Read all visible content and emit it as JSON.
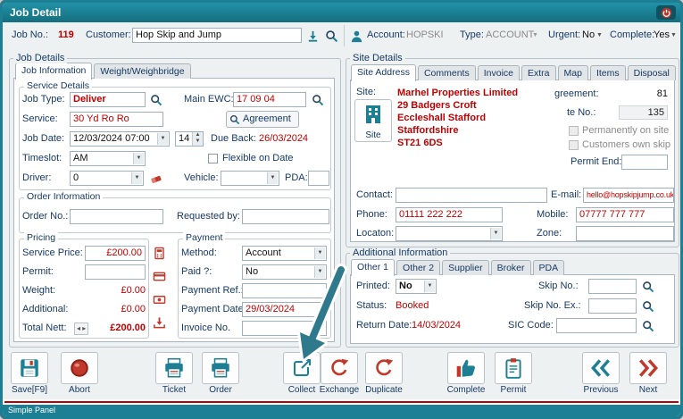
{
  "window": {
    "title": "Job Detail"
  },
  "header": {
    "job_no_label": "Job No.:",
    "job_no": "119",
    "customer_label": "Customer:",
    "customer_value": "Hop Skip and Jump",
    "account_label": "Account:",
    "account_value": "HOPSKI",
    "type_label": "Type:",
    "type_value": "ACCOUNT",
    "urgent_label": "Urgent:",
    "urgent_value": "No",
    "complete_label": "Complete:",
    "complete_value": "Yes"
  },
  "job": {
    "group_label": "Job Details",
    "tabs": [
      "Job Information",
      "Weight/Weighbridge"
    ],
    "service": {
      "legend": "Service Details",
      "job_type_label": "Job Type:",
      "job_type": "Deliver",
      "main_ewc_label": "Main EWC:",
      "main_ewc": "17 09 04",
      "service_label": "Service:",
      "service_value": "30 Yd Ro Ro",
      "agreement_button": "Agreement",
      "job_date_label": "Job Date:",
      "job_date": "12/03/2024 07:00",
      "duration": "14",
      "due_back_label": "Due Back:",
      "due_back": "26/03/2024",
      "timeslot_label": "Timeslot:",
      "timeslot": "AM",
      "flexible_label": "Flexible on Date",
      "driver_label": "Driver:",
      "driver": "0",
      "vehicle_label": "Vehicle:",
      "pda_label": "PDA:"
    },
    "order": {
      "legend": "Order Information",
      "order_no_label": "Order No.:",
      "requested_by_label": "Requested by:"
    },
    "pricing": {
      "legend": "Pricing",
      "service_price_label": "Service Price:",
      "service_price": "£200.00",
      "permit_label": "Permit:",
      "weight_label": "Weight:",
      "weight": "£0.00",
      "additional_label": "Additional:",
      "additional": "£0.00",
      "total_nett_label": "Total Nett:",
      "total_nett": "£200.00"
    },
    "payment": {
      "legend": "Payment",
      "method_label": "Method:",
      "method": "Account",
      "paid_label": "Paid ?:",
      "paid": "No",
      "payment_ref_label": "Payment Ref.:",
      "payment_date_label": "Payment Date:",
      "payment_date": "29/03/2024",
      "invoice_no_label": "Invoice No."
    }
  },
  "site": {
    "group_label": "Site Details",
    "tabs": [
      "Site Address",
      "Comments",
      "Invoice",
      "Extra",
      "Map",
      "Items",
      "Disposal"
    ],
    "site_label": "Site:",
    "site_button": "Site",
    "address": [
      "Marhel Properties Limited",
      "29 Badgers Croft",
      "Eccleshall Stafford",
      "Staffordshire",
      "ST21 6DS"
    ],
    "agreement_label": "greement:",
    "agreement_value": "81",
    "site_no_label": "te No.:",
    "site_no_value": "135",
    "permanently_label": "Permanently on site",
    "own_skip_label": "Customers own skip",
    "permit_end_label": "Permit End:",
    "contact_label": "Contact:",
    "email_label": "E-mail:",
    "email": "hello@hopskipjump.co.uk",
    "phone_label": "Phone:",
    "phone": "01111 222 222",
    "mobile_label": "Mobile:",
    "mobile": "07777 777 777",
    "location_label": "Locaton:",
    "zone_label": "Zone:"
  },
  "additional": {
    "group_label": "Additional Information",
    "tabs": [
      "Other 1",
      "Other 2",
      "Supplier",
      "Broker",
      "PDA"
    ],
    "printed_label": "Printed:",
    "printed": "No",
    "status_label": "Status:",
    "status": "Booked",
    "return_date_label": "Return Date:",
    "return_date": "14/03/2024",
    "skip_no_label": "Skip No.:",
    "skip_no_ex_label": "Skip No. Ex.:",
    "sic_code_label": "SIC Code:"
  },
  "toolbar": {
    "buttons": [
      {
        "label": "Save[F9]",
        "icon": "save-icon"
      },
      {
        "label": "Abort",
        "icon": "abort-icon"
      },
      {
        "label": "Ticket",
        "icon": "printer-icon"
      },
      {
        "label": "Order",
        "icon": "printer-icon"
      },
      {
        "label": "Collect",
        "icon": "export-icon"
      },
      {
        "label": "Exchange",
        "icon": "refresh-icon"
      },
      {
        "label": "Duplicate",
        "icon": "refresh-icon"
      },
      {
        "label": "Complete",
        "icon": "thumbs-up-icon"
      },
      {
        "label": "Permit",
        "icon": "clipboard-icon"
      },
      {
        "label": "Previous",
        "icon": "chevrons-left-icon"
      },
      {
        "label": "Next",
        "icon": "chevrons-right-icon"
      }
    ]
  },
  "statusbar": {
    "text": "Simple Panel"
  },
  "colors": {
    "titlebar": "#1c7f93",
    "accent_red": "#c00000",
    "icon_red": "#c0392b",
    "teal": "#1c7f93"
  }
}
